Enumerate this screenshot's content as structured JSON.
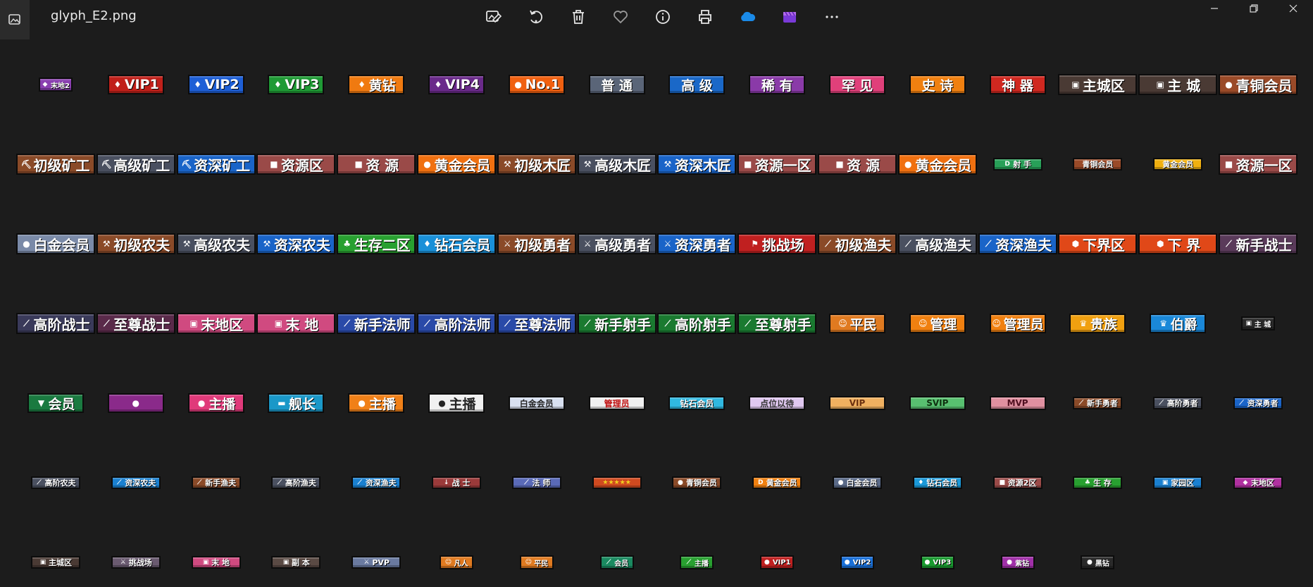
{
  "window": {
    "file_name": "glyph_E2.png"
  },
  "toolbar": {
    "items": [
      {
        "name": "edit-image-button",
        "icon": "edit-image-icon"
      },
      {
        "name": "rotate-button",
        "icon": "rotate-icon"
      },
      {
        "name": "delete-button",
        "icon": "trash-icon"
      },
      {
        "name": "favorite-button",
        "icon": "heart-icon"
      },
      {
        "name": "info-button",
        "icon": "info-icon"
      },
      {
        "name": "print-button",
        "icon": "printer-icon"
      },
      {
        "name": "onedrive-button",
        "icon": "cloud-icon"
      },
      {
        "name": "clipchamp-button",
        "icon": "clipchamp-icon"
      },
      {
        "name": "more-button",
        "icon": "more-dots-icon"
      }
    ]
  },
  "rows": [
    [
      {
        "t": "末地2",
        "bg": "#8a3fb0",
        "sz": "t",
        "ic": "◆"
      },
      {
        "t": "VIP1",
        "bg": "#c0201a",
        "sz": "l",
        "ic": "♦"
      },
      {
        "t": "VIP2",
        "bg": "#1e5fd6",
        "sz": "l",
        "ic": "♦"
      },
      {
        "t": "VIP3",
        "bg": "#1f9a35",
        "sz": "l",
        "ic": "♦"
      },
      {
        "t": "黄钻",
        "bg": "#f07a10",
        "sz": "l",
        "ic": "♦"
      },
      {
        "t": "VIP4",
        "bg": "#6a2a8a",
        "sz": "l",
        "ic": "♦"
      },
      {
        "t": "No.1",
        "bg": "#f06010",
        "sz": "l",
        "ic": "●"
      },
      {
        "t": "普 通",
        "bg": "#5a6578",
        "sz": "l",
        "ic": ""
      },
      {
        "t": "高 级",
        "bg": "#1a68c8",
        "sz": "l",
        "ic": ""
      },
      {
        "t": "稀 有",
        "bg": "#8a3aa8",
        "sz": "l",
        "ic": ""
      },
      {
        "t": "罕 见",
        "bg": "#e0407a",
        "sz": "l",
        "ic": ""
      },
      {
        "t": "史 诗",
        "bg": "#f08010",
        "sz": "l",
        "ic": ""
      },
      {
        "t": "神 器",
        "bg": "#d02820",
        "sz": "l",
        "ic": ""
      },
      {
        "t": "主城区",
        "bg": "#4a3a34",
        "sz": "xl",
        "ic": "▣"
      },
      {
        "t": "主 城",
        "bg": "#4a3a34",
        "sz": "xl",
        "ic": "▣"
      },
      {
        "t": "青铜会员",
        "bg": "#9a4a28",
        "sz": "xl",
        "ic": "●"
      }
    ],
    [
      {
        "t": "初级矿工",
        "bg": "#8a4a28",
        "sz": "xl",
        "ic": "⛏"
      },
      {
        "t": "高级矿工",
        "bg": "#4a5060",
        "sz": "xl",
        "ic": "⛏"
      },
      {
        "t": "资深矿工",
        "bg": "#1a64c8",
        "sz": "xl",
        "ic": "⛏"
      },
      {
        "t": "资源区",
        "bg": "#9a4a48",
        "sz": "xl",
        "ic": "■"
      },
      {
        "t": "资 源",
        "bg": "#9a4a48",
        "sz": "xl",
        "ic": "■"
      },
      {
        "t": "黄金会员",
        "bg": "#f07010",
        "sz": "xl",
        "ic": "●"
      },
      {
        "t": "初级木匠",
        "bg": "#8a4a28",
        "sz": "xl",
        "ic": "⚒"
      },
      {
        "t": "高级木匠",
        "bg": "#4a5060",
        "sz": "xl",
        "ic": "⚒"
      },
      {
        "t": "资深木匠",
        "bg": "#1a64c8",
        "sz": "xl",
        "ic": "⚒"
      },
      {
        "t": "资源一区",
        "bg": "#9a4a48",
        "sz": "xl",
        "ic": "■"
      },
      {
        "t": "资 源",
        "bg": "#9a4a48",
        "sz": "xl",
        "ic": "■"
      },
      {
        "t": "黄金会员",
        "bg": "#f07010",
        "sz": "xl",
        "ic": "●"
      },
      {
        "t": "射 手",
        "bg": "#28a058",
        "sz": "s",
        "ic": "D"
      },
      {
        "t": "青铜会员",
        "bg": "#9a4a28",
        "sz": "s",
        "ic": ""
      },
      {
        "t": "黄金会员",
        "bg": "#f0b010",
        "sz": "s",
        "ic": ""
      },
      {
        "t": "资源一区",
        "bg": "#9a4a48",
        "sz": "xl",
        "ic": "■"
      }
    ],
    [
      {
        "t": "白金会员",
        "bg": "#7a8aa8",
        "sz": "xl",
        "ic": "●"
      },
      {
        "t": "初级农夫",
        "bg": "#8a4a28",
        "sz": "xl",
        "ic": "⚒"
      },
      {
        "t": "高级农夫",
        "bg": "#4a5060",
        "sz": "xl",
        "ic": "⚒"
      },
      {
        "t": "资深农夫",
        "bg": "#1a64c8",
        "sz": "xl",
        "ic": "⚒"
      },
      {
        "t": "生存二区",
        "bg": "#28a030",
        "sz": "xl",
        "ic": "♣"
      },
      {
        "t": "钻石会员",
        "bg": "#1a90d8",
        "sz": "xl",
        "ic": "♦"
      },
      {
        "t": "初级勇者",
        "bg": "#8a4a28",
        "sz": "xl",
        "ic": "⚔"
      },
      {
        "t": "高级勇者",
        "bg": "#4a5060",
        "sz": "xl",
        "ic": "⚔"
      },
      {
        "t": "资深勇者",
        "bg": "#1a64c8",
        "sz": "xl",
        "ic": "⚔"
      },
      {
        "t": "挑战场",
        "bg": "#c02020",
        "sz": "xl",
        "ic": "⚑"
      },
      {
        "t": "初级渔夫",
        "bg": "#8a4a28",
        "sz": "xl",
        "ic": "⟋"
      },
      {
        "t": "高级渔夫",
        "bg": "#4a5060",
        "sz": "xl",
        "ic": "⟋"
      },
      {
        "t": "资深渔夫",
        "bg": "#1a64c8",
        "sz": "xl",
        "ic": "⟋"
      },
      {
        "t": "下界区",
        "bg": "#e04818",
        "sz": "xl",
        "ic": "⬢"
      },
      {
        "t": "下 界",
        "bg": "#e04818",
        "sz": "xl",
        "ic": "⬢"
      },
      {
        "t": "新手战士",
        "bg": "#5a3a5a",
        "sz": "xl",
        "ic": "⟋"
      }
    ],
    [
      {
        "t": "高阶战士",
        "bg": "#3a3a5a",
        "sz": "xl",
        "ic": "⟋"
      },
      {
        "t": "至尊战士",
        "bg": "#5a2a4a",
        "sz": "xl",
        "ic": "⟋"
      },
      {
        "t": "末地区",
        "bg": "#d04a80",
        "sz": "xl",
        "ic": "▣"
      },
      {
        "t": "末 地",
        "bg": "#d04a80",
        "sz": "xl",
        "ic": "▣"
      },
      {
        "t": "新手法师",
        "bg": "#2a4aa8",
        "sz": "xl",
        "ic": "⟋"
      },
      {
        "t": "高阶法师",
        "bg": "#2a4aa8",
        "sz": "xl",
        "ic": "⟋"
      },
      {
        "t": "至尊法师",
        "bg": "#2a4aa8",
        "sz": "xl",
        "ic": "⟋"
      },
      {
        "t": "新手射手",
        "bg": "#1a7a30",
        "sz": "xl",
        "ic": "⟋"
      },
      {
        "t": "高阶射手",
        "bg": "#1a7a30",
        "sz": "xl",
        "ic": "⟋"
      },
      {
        "t": "至尊射手",
        "bg": "#1a7a30",
        "sz": "xl",
        "ic": "⟋"
      },
      {
        "t": "平民",
        "bg": "#e07a20",
        "sz": "l",
        "ic": "☺"
      },
      {
        "t": "管理",
        "bg": "#f08010",
        "sz": "l",
        "ic": "☺"
      },
      {
        "t": "管理员",
        "bg": "#f08010",
        "sz": "l",
        "ic": "☺"
      },
      {
        "t": "贵族",
        "bg": "#f0a010",
        "sz": "l",
        "ic": "♛"
      },
      {
        "t": "伯爵",
        "bg": "#1a88d8",
        "sz": "l",
        "ic": "♛"
      },
      {
        "t": "主 城",
        "bg": "#2a2a2a",
        "sz": "t",
        "ic": "▣"
      }
    ],
    [
      {
        "t": "会员",
        "bg": "#1a7a40",
        "sz": "l",
        "ic": "▼"
      },
      {
        "t": "",
        "bg": "#8a2a8a",
        "sz": "l",
        "ic": "●"
      },
      {
        "t": "主播",
        "bg": "#e03a7a",
        "sz": "l",
        "ic": "●"
      },
      {
        "t": "舰长",
        "bg": "#1a98c8",
        "sz": "l",
        "ic": "▬"
      },
      {
        "t": "主播",
        "bg": "#f08018",
        "sz": "l",
        "ic": "●"
      },
      {
        "t": "主播",
        "bg": "#f0f0f0",
        "sz": "l",
        "ic": "●",
        "fg": "#222"
      },
      {
        "t": "白金会员",
        "bg": "#d8e0f0",
        "sz": "m",
        "ic": "",
        "fg": "#222"
      },
      {
        "t": "管理员",
        "bg": "#f0f0f0",
        "sz": "m",
        "ic": "",
        "fg": "#c01010"
      },
      {
        "t": "钻石会员",
        "bg": "#30b8e0",
        "sz": "m",
        "ic": ""
      },
      {
        "t": "点位以待",
        "bg": "#e0c8f0",
        "sz": "m",
        "ic": "",
        "fg": "#333"
      },
      {
        "t": "VIP",
        "bg": "#f0b060",
        "sz": "m",
        "ic": "",
        "fg": "#6a3010"
      },
      {
        "t": "SVIP",
        "bg": "#58c070",
        "sz": "m",
        "ic": "",
        "fg": "#103010"
      },
      {
        "t": "MVP",
        "bg": "#e090a0",
        "sz": "m",
        "ic": "",
        "fg": "#501020"
      },
      {
        "t": "新手勇者",
        "bg": "#8a4a28",
        "sz": "s",
        "ic": "⟋"
      },
      {
        "t": "高阶勇者",
        "bg": "#4a5060",
        "sz": "s",
        "ic": "⟋"
      },
      {
        "t": "资深勇者",
        "bg": "#1a64c8",
        "sz": "s",
        "ic": "⟋"
      }
    ],
    [
      {
        "t": "高阶农夫",
        "bg": "#4a5060",
        "sz": "s",
        "ic": "⟋"
      },
      {
        "t": "资深农夫",
        "bg": "#1a80d0",
        "sz": "s",
        "ic": "⟋"
      },
      {
        "t": "新手渔夫",
        "bg": "#8a4a28",
        "sz": "s",
        "ic": "⟋"
      },
      {
        "t": "高阶渔夫",
        "bg": "#4a5060",
        "sz": "s",
        "ic": "⟋"
      },
      {
        "t": "资深渔夫",
        "bg": "#1a80d0",
        "sz": "s",
        "ic": "⟋"
      },
      {
        "t": "战 士",
        "bg": "#9a3a3a",
        "sz": "s",
        "ic": "↓"
      },
      {
        "t": "法 师",
        "bg": "#5a6ab8",
        "sz": "s",
        "ic": "⟋"
      },
      {
        "t": "",
        "bg": "#d04a20",
        "sz": "s",
        "ic": "★★★★★"
      },
      {
        "t": "青铜会员",
        "bg": "#8a4a28",
        "sz": "s",
        "ic": "●"
      },
      {
        "t": "黄金会员",
        "bg": "#f08010",
        "sz": "s",
        "ic": "D"
      },
      {
        "t": "白金会员",
        "bg": "#5a6a88",
        "sz": "s",
        "ic": "●"
      },
      {
        "t": "钻石会员",
        "bg": "#1a98d8",
        "sz": "s",
        "ic": "♦"
      },
      {
        "t": "资源2区",
        "bg": "#9a4a48",
        "sz": "s",
        "ic": "■"
      },
      {
        "t": "生 存",
        "bg": "#28a030",
        "sz": "s",
        "ic": "♣"
      },
      {
        "t": "家园区",
        "bg": "#1a80d0",
        "sz": "s",
        "ic": "▣"
      },
      {
        "t": "末地区",
        "bg": "#b030a0",
        "sz": "s",
        "ic": "◆"
      }
    ],
    [
      {
        "t": "主城区",
        "bg": "#4a3a34",
        "sz": "s",
        "ic": "▣"
      },
      {
        "t": "挑战场",
        "bg": "#6a5a70",
        "sz": "s",
        "ic": "⚔"
      },
      {
        "t": "末 地",
        "bg": "#d04a80",
        "sz": "s",
        "ic": "▣"
      },
      {
        "t": "副 本",
        "bg": "#5a4a44",
        "sz": "s",
        "ic": "▣"
      },
      {
        "t": "PVP",
        "bg": "#6a7aa0",
        "sz": "s",
        "ic": "⚔"
      },
      {
        "t": "凡人",
        "bg": "#e07a20",
        "sz": "t",
        "ic": "☺"
      },
      {
        "t": "平民",
        "bg": "#e07a20",
        "sz": "t",
        "ic": "☺"
      },
      {
        "t": "会员",
        "bg": "#1a8a60",
        "sz": "t",
        "ic": "⟋"
      },
      {
        "t": "主播",
        "bg": "#28a030",
        "sz": "t",
        "ic": "⟋"
      },
      {
        "t": "VIP1",
        "bg": "#c02020",
        "sz": "t",
        "ic": "●"
      },
      {
        "t": "VIP2",
        "bg": "#1a70d8",
        "sz": "t",
        "ic": "●"
      },
      {
        "t": "VIP3",
        "bg": "#1a9a30",
        "sz": "t",
        "ic": "●"
      },
      {
        "t": "紫钻",
        "bg": "#a030a8",
        "sz": "t",
        "ic": "●"
      },
      {
        "t": "黑钻",
        "bg": "#2a2a2a",
        "sz": "t",
        "ic": "●"
      },
      {
        "t": "",
        "bg": "",
        "sz": "none",
        "ic": ""
      },
      {
        "t": "",
        "bg": "",
        "sz": "none",
        "ic": ""
      }
    ]
  ]
}
